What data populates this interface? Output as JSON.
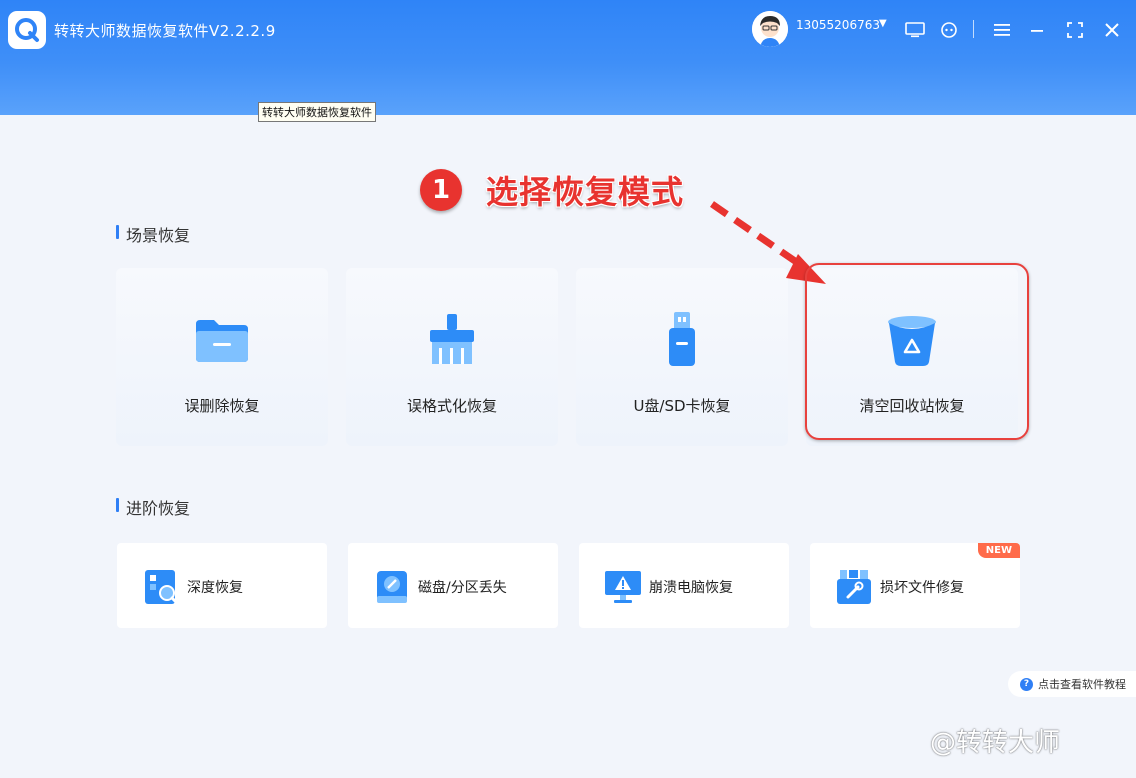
{
  "window": {
    "title": "转转大师数据恢复软件V2.2.2.9",
    "tooltip": "转转大师数据恢复软件",
    "account": "13055206763"
  },
  "header_icons": [
    "screen-icon",
    "support-icon",
    "menu-icon",
    "minimize-icon",
    "maximize-icon",
    "close-icon"
  ],
  "annotation": {
    "step_number": "1",
    "step_text": "选择恢复模式"
  },
  "scene_section": {
    "title": "场景恢复",
    "cards": [
      {
        "label": "误删除恢复",
        "icon": "folder-icon"
      },
      {
        "label": "误格式化恢复",
        "icon": "brush-icon"
      },
      {
        "label": "U盘/SD卡恢复",
        "icon": "usb-drive-icon"
      },
      {
        "label": "清空回收站恢复",
        "icon": "recycle-bin-icon"
      }
    ]
  },
  "advanced_section": {
    "title": "进阶恢复",
    "cards": [
      {
        "label": "深度恢复",
        "icon": "deep-scan-icon"
      },
      {
        "label": "磁盘/分区丢失",
        "icon": "disk-icon"
      },
      {
        "label": "崩溃电脑恢复",
        "icon": "crashed-pc-icon"
      },
      {
        "label": "损坏文件修复",
        "icon": "file-repair-icon",
        "badge": "NEW"
      }
    ]
  },
  "help": {
    "label": "点击查看软件教程"
  },
  "watermark": "@转转大师",
  "colors": {
    "accent": "#2f7ff5",
    "annotation_red": "#e8332f",
    "badge": "#ff6b4a"
  }
}
